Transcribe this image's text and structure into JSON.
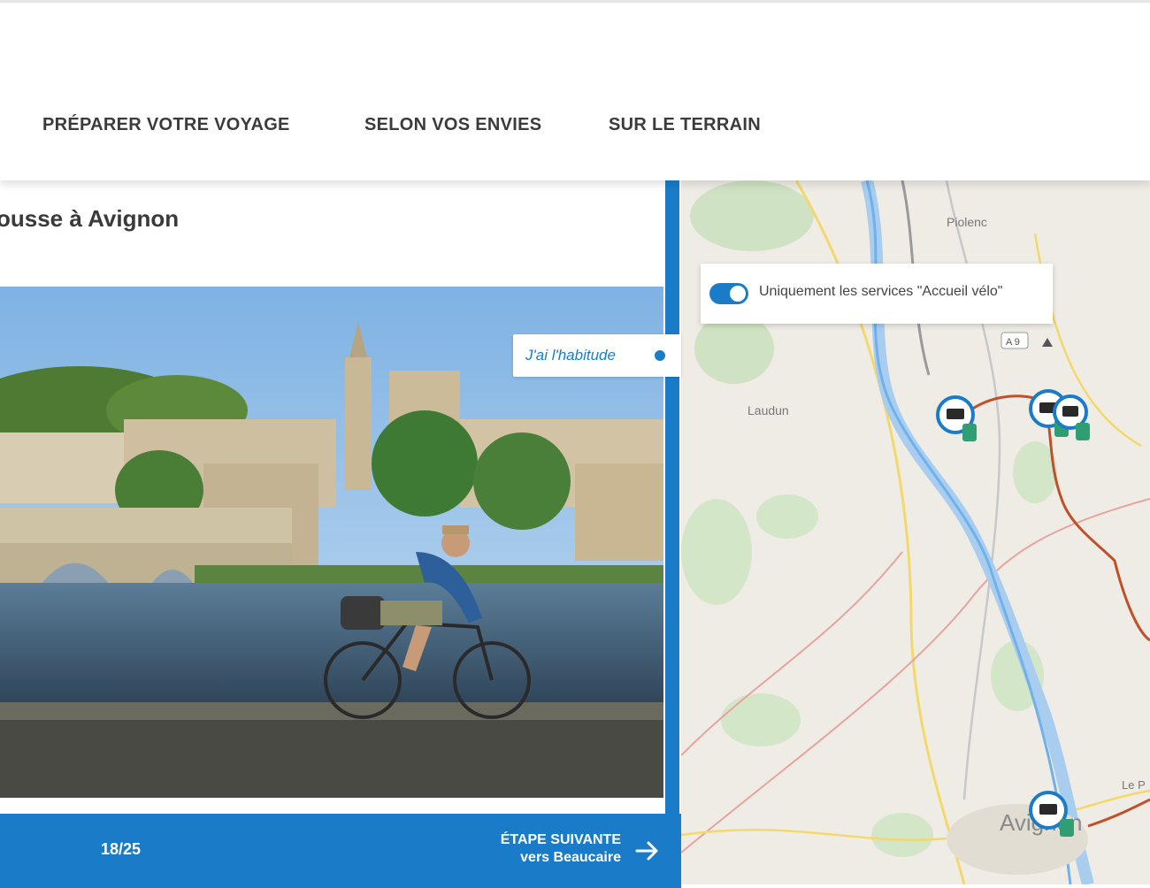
{
  "nav": {
    "items": [
      {
        "label": "PRÉPARER VOTRE VOYAGE"
      },
      {
        "label": "SELON VOS ENVIES"
      },
      {
        "label": "SUR LE TERRAIN"
      }
    ]
  },
  "stage": {
    "title": "ousse à Avignon",
    "mode_toggle": "J'ai l'habitude",
    "counter": "18/25",
    "next_line1": "ÉTAPE SUIVANTE",
    "next_line2": "vers Beaucaire"
  },
  "map": {
    "filter_label": "Uniquement les services \"Accueil vélo\"",
    "filter_on": true,
    "place_labels": [
      "Piolenc",
      "Laudun",
      "Avignon",
      "Le P",
      "A 9"
    ]
  },
  "colors": {
    "accent": "#1a7cc9",
    "route": "#c0502a",
    "marker": "#2f9e73",
    "nav_text": "#3b3b3b"
  }
}
